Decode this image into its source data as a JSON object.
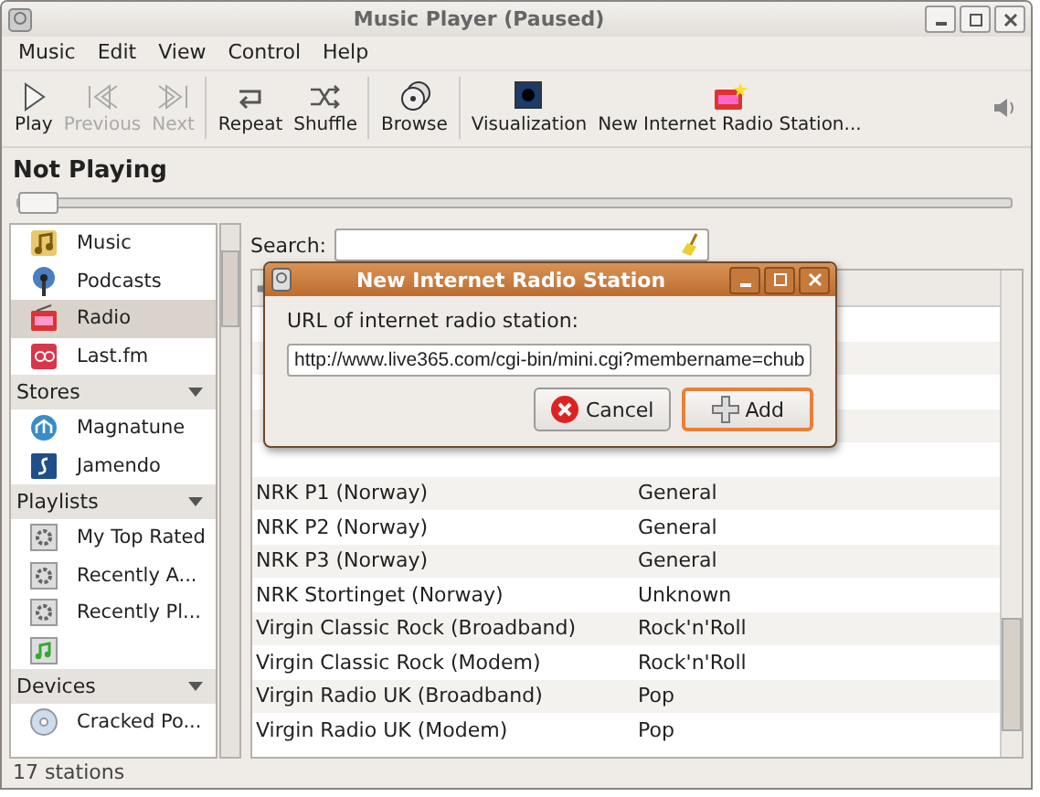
{
  "window": {
    "title": "Music Player (Paused)"
  },
  "menu": [
    {
      "label": "Music"
    },
    {
      "label": "Edit"
    },
    {
      "label": "View"
    },
    {
      "label": "Control"
    },
    {
      "label": "Help"
    }
  ],
  "toolbar": {
    "groups": [
      {
        "buttons": [
          {
            "label": "Play",
            "kind": "play",
            "disabled": false
          },
          {
            "label": "Previous",
            "kind": "previous",
            "disabled": true
          },
          {
            "label": "Next",
            "kind": "next",
            "disabled": true
          }
        ]
      },
      {
        "buttons": [
          {
            "label": "Repeat",
            "kind": "repeat",
            "disabled": false
          },
          {
            "label": "Shuffle",
            "kind": "shuffle",
            "disabled": false
          }
        ]
      },
      {
        "buttons": [
          {
            "label": "Browse",
            "kind": "browse",
            "disabled": false
          }
        ]
      },
      {
        "buttons": [
          {
            "label": "Visualization",
            "kind": "visualization",
            "disabled": false
          },
          {
            "label": "New Internet Radio Station...",
            "kind": "radio",
            "disabled": false
          }
        ]
      }
    ]
  },
  "now_playing": "Not Playing",
  "seek": {
    "level": 0
  },
  "sidebar": {
    "sections": [
      {
        "items": [
          {
            "label": "Music",
            "kind": "music",
            "selected": false
          },
          {
            "label": "Podcasts",
            "kind": "podcast",
            "selected": false
          },
          {
            "label": "Radio",
            "kind": "radio",
            "selected": true
          },
          {
            "label": "Last.fm",
            "kind": "lastfm",
            "selected": false
          }
        ]
      },
      {
        "header": "Stores",
        "expanded": true,
        "items": [
          {
            "label": "Magnatune",
            "kind": "magnatune",
            "selected": false
          },
          {
            "label": "Jamendo",
            "kind": "jamendo",
            "selected": false
          }
        ]
      },
      {
        "header": "Playlists",
        "expanded": true,
        "items": [
          {
            "label": "My Top Rated",
            "kind": "smart",
            "selected": false
          },
          {
            "label": "Recently A...",
            "kind": "smart",
            "selected": false
          },
          {
            "label": "Recently Pl...",
            "kind": "smart",
            "selected": false
          },
          {
            "kind": "playlist",
            "selected": false
          }
        ]
      },
      {
        "header": "Devices",
        "expanded": true,
        "items": [
          {
            "label": "Cracked Po...",
            "kind": "disc",
            "selected": false
          }
        ]
      }
    ]
  },
  "search": {
    "label": "Search:"
  },
  "table": {
    "rows": [
      {
        "title": "NRK P1 (Norway)",
        "genre": "General"
      },
      {
        "title": "NRK P2 (Norway)",
        "genre": "General"
      },
      {
        "title": "NRK P3 (Norway)",
        "genre": "General"
      },
      {
        "title": "NRK Stortinget (Norway)",
        "genre": "Unknown"
      },
      {
        "title": "Virgin Classic Rock (Broadband)",
        "genre": "Rock'n'Roll"
      },
      {
        "title": "Virgin Classic Rock (Modem)",
        "genre": "Rock'n'Roll"
      },
      {
        "title": "Virgin Radio UK (Broadband)",
        "genre": "Pop"
      },
      {
        "title": "Virgin Radio UK (Modem)",
        "genre": "Pop"
      }
    ]
  },
  "status_bar": {
    "text": "17 stations"
  },
  "dialog": {
    "title": "New Internet Radio Station",
    "prompt": "URL of internet radio station:",
    "url": "http://www.live365.com/cgi-bin/mini.cgi?membername=chub",
    "buttons": [
      {
        "label": "Cancel",
        "kind": "cancel",
        "focused": false
      },
      {
        "label": "Add",
        "kind": "add",
        "focused": true
      }
    ]
  }
}
